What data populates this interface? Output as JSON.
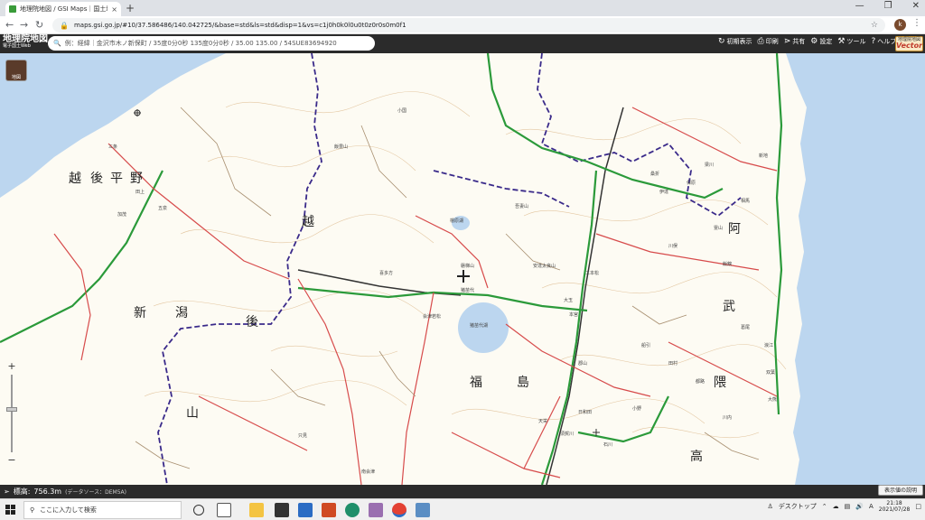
{
  "browser": {
    "tab_title": "地理院地図 / GSI Maps｜国土地理",
    "tab_close": "×",
    "new_tab": "+",
    "url": "maps.gsi.go.jp/#10/37.586486/140.042725/&base=std&ls=std&disp=1&vs=c1j0h0k0l0u0t0z0r0s0m0f1",
    "profile_initial": "k"
  },
  "gsi": {
    "logo_main": "地理院地図",
    "logo_sub": "電子国土Web",
    "search_placeholder": "例：経緯｜金沢市木ノ新保町 / 35度0分0秒 135度0分0秒 / 35.00 135.00 / 54SUE83694920",
    "toolbar": [
      {
        "label": "初期表示",
        "icon": "reset-icon"
      },
      {
        "label": "印刷",
        "icon": "print-icon"
      },
      {
        "label": "共有",
        "icon": "share-icon"
      },
      {
        "label": "設定",
        "icon": "gear-icon"
      },
      {
        "label": "ツール",
        "icon": "tool-icon"
      },
      {
        "label": "ヘルプ",
        "icon": "help-icon"
      }
    ],
    "vector_line1": "地理院地図",
    "vector_line2": "Vector",
    "layer_button": "地図"
  },
  "map": {
    "region_labels": [
      "越",
      "後",
      "平",
      "野",
      "新",
      "潟",
      "越",
      "後",
      "山",
      "福",
      "島",
      "阿",
      "武",
      "隈",
      "高"
    ],
    "place_labels": [
      "猪苗代湖",
      "檜原湖",
      "猪苗代",
      "会津若松",
      "喜多方",
      "小野",
      "郡山",
      "大玉",
      "本宮",
      "二本松",
      "三条",
      "田上",
      "加茂",
      "五泉",
      "小国",
      "飯豊山",
      "磐梯山",
      "安達太良山",
      "吾妻山",
      "日和田",
      "天栄",
      "石川",
      "須賀川",
      "只見",
      "南会津",
      "相馬",
      "大熊",
      "双葉",
      "浪江",
      "川内",
      "都路",
      "田村",
      "船引",
      "葛尾",
      "飯舘",
      "川俣",
      "桑折",
      "伊達",
      "保原",
      "梁川",
      "霊山",
      "新地"
    ]
  },
  "status": {
    "elevation_label": "標高:",
    "elevation_value": "756.3m",
    "elevation_source": "(データソース：DEM5A)",
    "legend_button": "表示値の説明"
  },
  "taskbar": {
    "search_placeholder": "ここに入力して検索",
    "desktop_label": "デスクトップ",
    "ime": "A",
    "time": "21:18",
    "date": "2021/07/28"
  }
}
